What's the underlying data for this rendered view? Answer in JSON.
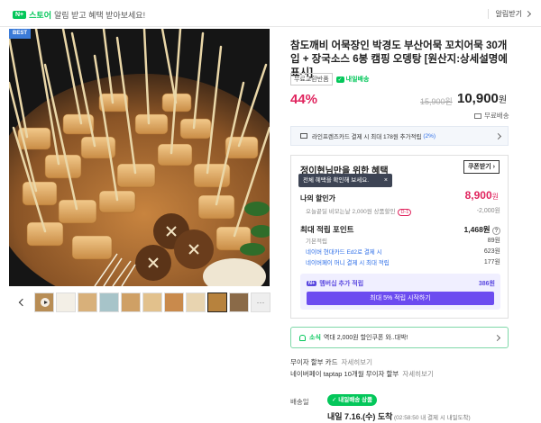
{
  "topbar": {
    "store_label": "스토어",
    "npay_chip": "N+",
    "message": "알림 받고 혜택 받아보세요!",
    "right_link": "알림받기"
  },
  "product": {
    "best_tag": "BEST",
    "title": "참도깨비 어묵장인 박경도 부산어묵 꼬치어묵 30개입 + 장국소스 6봉 캠핑 오뎅탕 [원산지:상세설명에 표시]",
    "badge_gray": "무료교환반품",
    "badge_green": "내일배송",
    "discount": "44%",
    "original_price": "15,900원",
    "sale_price": "10,900",
    "sale_unit": "원",
    "shipping": "무료배송",
    "thumb_more": "···"
  },
  "card_banner": {
    "prefix": "라인프렌즈카드 결제 시 최대 178원 추가적립",
    "highlight": "(2%)"
  },
  "benefit": {
    "title": "정이현님만을 위한 혜택",
    "coupon_button": "쿠폰받기",
    "tooltip": "전체 혜택을 확인해 보세요.",
    "tooltip_close": "×",
    "my_discount_label": "나의 할인가",
    "my_discount_price": "8,900",
    "my_discount_unit": "원",
    "coupon_row_label": "오늘끝딜 비모는날 2,000원 상품할인",
    "coupon_row_tag": "D-1",
    "coupon_row_value": "-2,000원",
    "points_label": "최대 적립 포인트",
    "points_value": "1,468원",
    "points_help": "?",
    "base_points_label": "기본적립",
    "base_points_value": "89원",
    "card_points_label": "네이버 현대카드 Ed2로 결제 시",
    "card_points_value": "623원",
    "money_points_label": "네이버페이 머니 결제 시 최대 적립",
    "money_points_value": "177원",
    "membership_label": "멤버십 추가 적립",
    "membership_chip": "N+",
    "membership_value": "386원",
    "membership_button": "최대 5% 적립 시작하기"
  },
  "notice": {
    "highlight": "소식",
    "text": "역대 2,000원 할인쿠폰 와..대박!"
  },
  "installment": {
    "row1_label": "무이자 할부 카드",
    "row1_see": "자세히보기",
    "row2_label": "네이버페이 taptap 10개월 무이자 할부",
    "row2_see": "자세히보기"
  },
  "delivery": {
    "label": "배송일",
    "badge": "내일배송 상품",
    "date": "내일 7.16.(수) 도착",
    "note": "(02:58:50 내 결제 시 내일도착)"
  },
  "colors": {
    "brand_green": "#03c75a",
    "discount_red": "#e0245e",
    "membership_purple": "#6c4cf0",
    "link_blue": "#2b6de8"
  }
}
